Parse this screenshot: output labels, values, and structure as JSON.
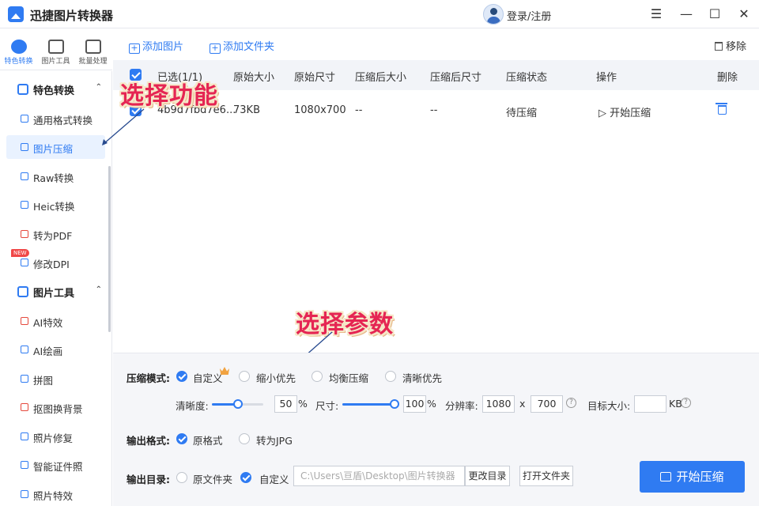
{
  "app": {
    "title": "迅捷图片转换器",
    "login": "登录/注册"
  },
  "window_controls": {
    "menu": "☰",
    "minimize": "—",
    "maximize": "☐",
    "close": "✕"
  },
  "top_tabs": [
    "特色转换",
    "图片工具",
    "批量处理"
  ],
  "sidebar": {
    "section1": {
      "label": "特色转换",
      "chevron": "⌃"
    },
    "items1": [
      {
        "label": "通用格式转换"
      },
      {
        "label": "图片压缩"
      },
      {
        "label": "Raw转换"
      },
      {
        "label": "Heic转换"
      },
      {
        "label": "转为PDF"
      },
      {
        "label": "修改DPI",
        "badge": "NEW"
      }
    ],
    "section2": {
      "label": "图片工具",
      "chevron": "⌃"
    },
    "items2": [
      {
        "label": "AI特效"
      },
      {
        "label": "AI绘画"
      },
      {
        "label": "拼图"
      },
      {
        "label": "抠图换背景"
      },
      {
        "label": "照片修复"
      },
      {
        "label": "智能证件照"
      },
      {
        "label": "照片特效"
      }
    ]
  },
  "toolbar": {
    "add_image": "添加图片",
    "add_folder": "添加文件夹",
    "remove": "移除"
  },
  "table": {
    "headers": [
      "已选(1/1)",
      "原始大小",
      "原始尺寸",
      "压缩后大小",
      "压缩后尺寸",
      "压缩状态",
      "操作",
      "删除"
    ],
    "rows": [
      {
        "name": "4b9d7fbd7e6...",
        "size": "73KB",
        "dimensions": "1080x700",
        "compressed_size": "--",
        "compressed_dimensions": "--",
        "status": "待压缩",
        "action": "开始压缩"
      }
    ]
  },
  "annotations": {
    "select_function": "选择功能",
    "select_params": "选择参数"
  },
  "settings": {
    "mode_label": "压缩模式:",
    "modes": [
      "自定义",
      "缩小优先",
      "均衡压缩",
      "清晰优先"
    ],
    "selected_mode": "自定义",
    "clarity_label": "清晰度:",
    "clarity_value": "50",
    "clarity_fraction": 0.5,
    "size_label": "尺寸:",
    "size_value": "100",
    "size_fraction": 1.0,
    "percent": "%",
    "resolution_label": "分辨率:",
    "res_width": "1080",
    "res_x": "x",
    "res_height": "700",
    "target_label": "目标大小:",
    "target_value": "",
    "target_unit": "KB",
    "help": "?",
    "format_label": "输出格式:",
    "formats": [
      "原格式",
      "转为JPG"
    ],
    "selected_format": "原格式",
    "dir_label": "输出目录:",
    "dirs": [
      "原文件夹",
      "自定义"
    ],
    "selected_dir": "自定义",
    "path": "C:\\Users\\亘盾\\Desktop\\图片转换器",
    "change_dir": "更改目录",
    "open_folder": "打开文件夹",
    "start": "开始压缩"
  },
  "colors": {
    "accent": "#2f7bf2",
    "annotation": "#e52553",
    "badge": "#f04848"
  }
}
